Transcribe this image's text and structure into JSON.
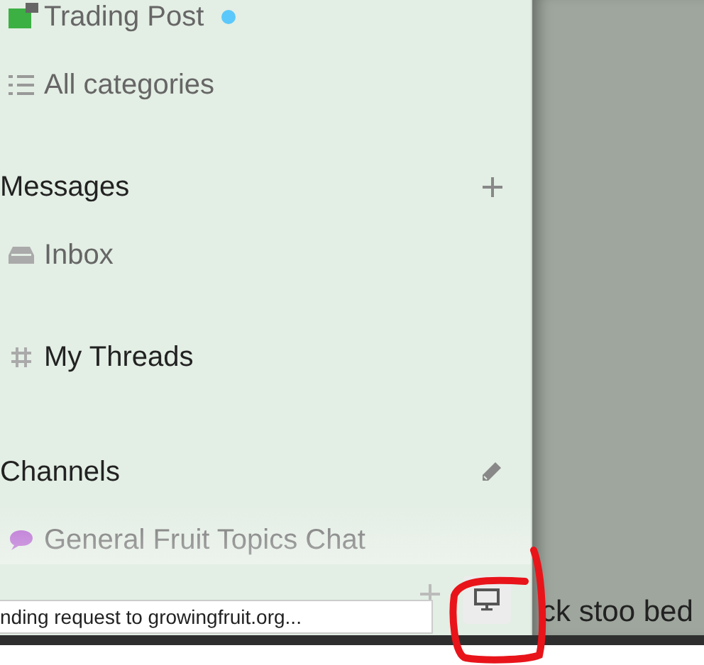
{
  "sidebar": {
    "items": [
      {
        "kind": "item",
        "label": "Trading Post",
        "unread": true,
        "selected": false
      },
      {
        "kind": "item",
        "label": "All categories",
        "unread": false,
        "selected": false
      },
      {
        "kind": "header",
        "label": "Messages"
      },
      {
        "kind": "item",
        "label": "Inbox",
        "unread": false,
        "selected": false
      },
      {
        "kind": "item",
        "label": "My Threads",
        "unread": false,
        "selected": true
      },
      {
        "kind": "header",
        "label": "Channels"
      },
      {
        "kind": "item",
        "label": "General Fruit Topics Chat",
        "unread": false,
        "selected": false
      }
    ]
  },
  "status_bar": {
    "text": "nding request to growingfruit.org..."
  },
  "main": {
    "text": "ck stoo bed"
  }
}
